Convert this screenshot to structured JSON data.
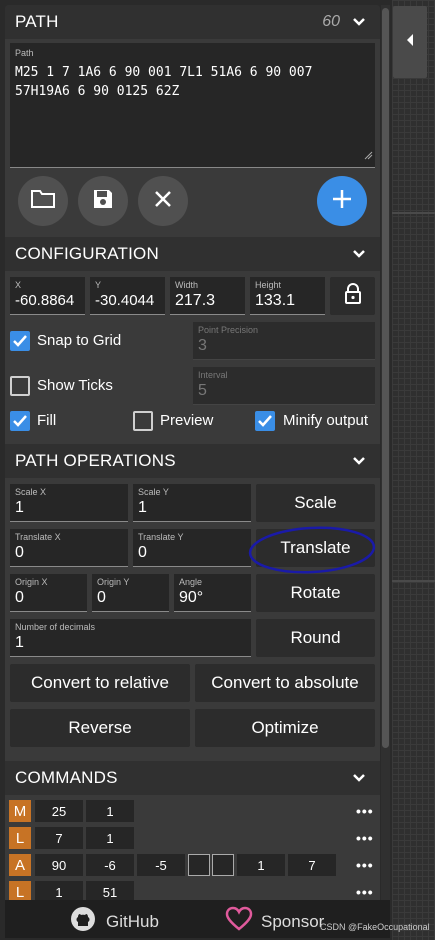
{
  "path_section": {
    "title": "PATH",
    "count": "60",
    "path_label": "Path",
    "path_line1": "M25 1 7 1A6 6 90 001 7L1 51A6 6 90 007",
    "path_line2": "57H19A6 6 90 0125 62Z"
  },
  "config": {
    "title": "CONFIGURATION",
    "x_label": "X",
    "x_value": "-60.8864",
    "y_label": "Y",
    "y_value": "-30.4044",
    "width_label": "Width",
    "width_value": "217.3",
    "height_label": "Height",
    "height_value": "133.1",
    "snap_label": "Snap to Grid",
    "point_precision_label": "Point Precision",
    "point_precision_value": "3",
    "show_ticks_label": "Show Ticks",
    "interval_label": "Interval",
    "interval_value": "5",
    "fill_label": "Fill",
    "preview_label": "Preview",
    "minify_label": "Minify output"
  },
  "ops": {
    "title": "PATH OPERATIONS",
    "scale_x_label": "Scale X",
    "scale_x_value": "1",
    "scale_y_label": "Scale Y",
    "scale_y_value": "1",
    "scale_button": "Scale",
    "translate_x_label": "Translate X",
    "translate_x_value": "0",
    "translate_y_label": "Translate Y",
    "translate_y_value": "0",
    "translate_button": "Translate",
    "origin_x_label": "Origin X",
    "origin_x_value": "0",
    "origin_y_label": "Origin Y",
    "origin_y_value": "0",
    "angle_label": "Angle",
    "angle_value": "90°",
    "rotate_button": "Rotate",
    "decimals_label": "Number of decimals",
    "decimals_value": "1",
    "round_button": "Round",
    "to_relative_button": "Convert to relative",
    "to_absolute_button": "Convert to absolute",
    "reverse_button": "Reverse",
    "optimize_button": "Optimize"
  },
  "commands": {
    "title": "COMMANDS",
    "rows": [
      {
        "letter": "M",
        "values": [
          "25",
          "1"
        ]
      },
      {
        "letter": "L",
        "values": [
          "7",
          "1"
        ]
      },
      {
        "letter": "A",
        "values": [
          "90",
          "-6",
          "-5",
          "",
          "",
          "1",
          "7"
        ]
      },
      {
        "letter": "L",
        "values": [
          "1",
          "51"
        ]
      }
    ],
    "more": "•••"
  },
  "footer": {
    "github_label": "GitHub",
    "sponsor_label": "Sponsor"
  },
  "watermark": "CSDN @FakeOccupational",
  "colors": {
    "accent": "#3a8ee6",
    "command_letter": "#c77325",
    "sponsor_heart": "#e05a9c",
    "annotation_circle": "#1a1aa8"
  }
}
